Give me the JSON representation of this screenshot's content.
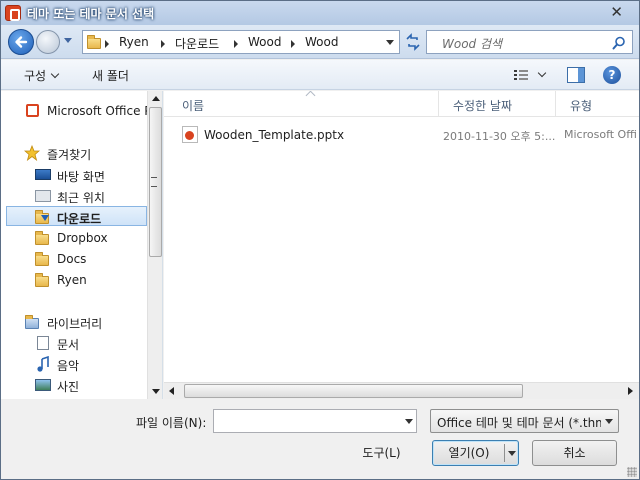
{
  "window": {
    "title": "테마 또는 테마 문서 선택",
    "close_glyph": "✕"
  },
  "address": {
    "crumbs": [
      "Ryen",
      "다운로드",
      "Wood",
      "Wood"
    ],
    "search_placeholder": "Wood 검색"
  },
  "commandbar": {
    "organize": "구성",
    "new_folder": "새 폴더"
  },
  "nav": {
    "items": [
      {
        "label": "Microsoft Office Po",
        "icon": "powerpoint-icon"
      },
      {
        "label": "즐겨찾기",
        "icon": "star-icon"
      },
      {
        "label": "바탕 화면",
        "icon": "desktop-icon"
      },
      {
        "label": "최근 위치",
        "icon": "recent-places-icon"
      },
      {
        "label": "다운로드",
        "icon": "downloads-folder-icon",
        "selected": true
      },
      {
        "label": "Dropbox",
        "icon": "folder-icon"
      },
      {
        "label": "Docs",
        "icon": "folder-icon"
      },
      {
        "label": "Ryen",
        "icon": "folder-icon"
      },
      {
        "label": "라이브러리",
        "icon": "library-icon"
      },
      {
        "label": "문서",
        "icon": "documents-icon"
      },
      {
        "label": "음악",
        "icon": "music-icon"
      },
      {
        "label": "사진",
        "icon": "pictures-icon"
      }
    ]
  },
  "filelist": {
    "columns": {
      "name": "이름",
      "modified": "수정한 날짜",
      "type": "유형"
    },
    "files": [
      {
        "name": "Wooden_Template.pptx",
        "modified": "2010-11-30 오후 5:...",
        "type": "Microsoft Offi"
      }
    ]
  },
  "footer": {
    "filename_label": "파일 이름(N):",
    "filename_value": "",
    "filetype_value": "Office 테마 및 테마 문서 (*.thm",
    "tools_label": "도구(L)",
    "open_label": "열기(O)",
    "cancel_label": "취소"
  },
  "colors": {
    "accent": "#1f5fb8",
    "selection": "#cfe3f8",
    "ppt_red": "#d9431f"
  }
}
